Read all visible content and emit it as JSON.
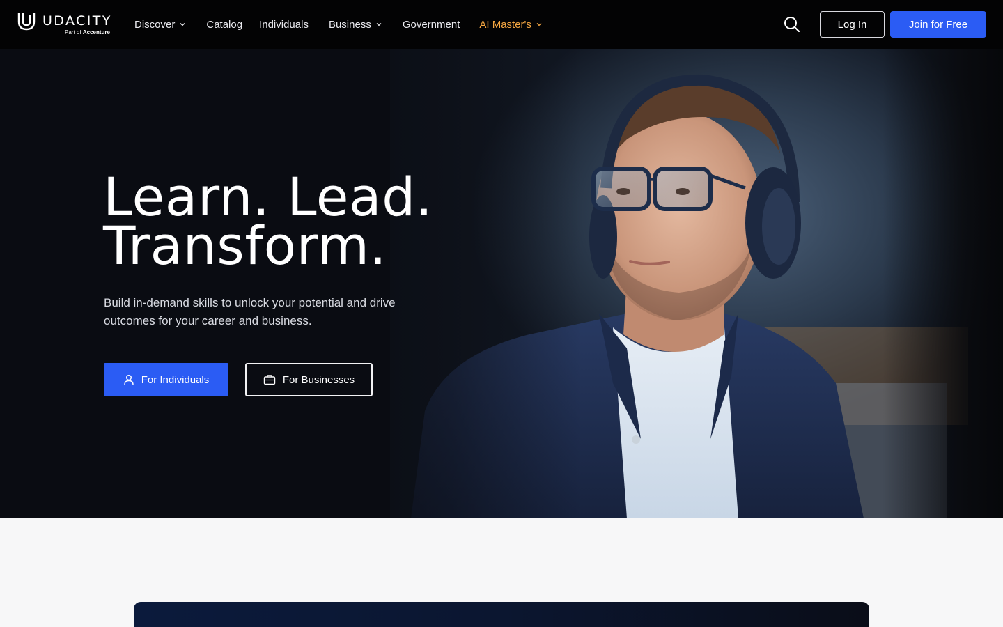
{
  "brand": {
    "name": "UDACITY",
    "tagline_prefix": "Part of",
    "tagline_company": "Accenture"
  },
  "nav": {
    "items": [
      {
        "label": "Discover",
        "dropdown": true
      },
      {
        "label": "Catalog",
        "dropdown": false
      },
      {
        "label": "Individuals",
        "dropdown": false
      },
      {
        "label": "Business",
        "dropdown": true
      },
      {
        "label": "Government",
        "dropdown": false
      },
      {
        "label": "AI Master's",
        "dropdown": true
      }
    ],
    "search_icon": "search-icon",
    "login_label": "Log In",
    "join_label": "Join for Free"
  },
  "hero": {
    "title_line1": "Learn. Lead.",
    "title_line2": "Transform.",
    "subtitle": "Build in-demand skills to unlock your potential and drive outcomes for your career and business.",
    "cta_individuals": "For Individuals",
    "cta_businesses": "For Businesses",
    "cta_individuals_icon": "user-icon",
    "cta_businesses_icon": "briefcase-icon"
  },
  "colors": {
    "nav_bg": "#030304",
    "primary_blue": "#2b5cf4",
    "accent_orange": "#f5a742",
    "hero_bg": "#0b0d12",
    "page_bg": "#f7f7f8"
  }
}
